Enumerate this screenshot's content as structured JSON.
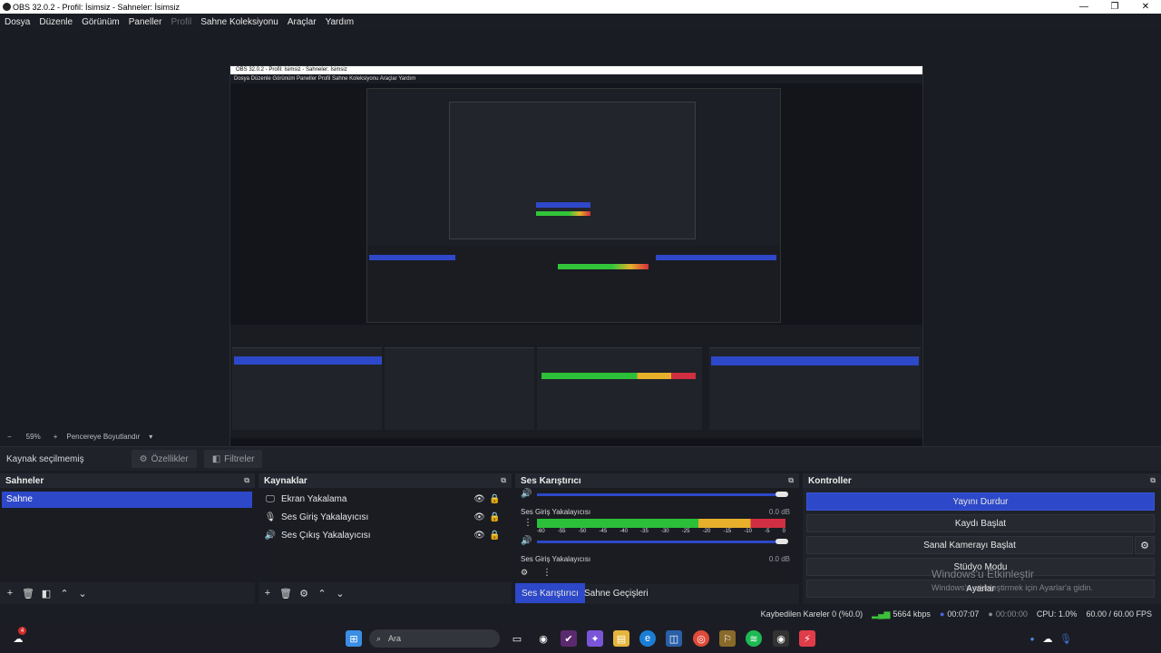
{
  "window": {
    "title": "OBS 32.0.2 - Profil: İsimsiz - Sahneler: İsimsiz",
    "controls": [
      "—",
      "❐",
      "✕"
    ]
  },
  "menu": [
    "Dosya",
    "Düzenle",
    "Görünüm",
    "Paneller",
    "Profil",
    "Sahne Koleksiyonu",
    "Araçlar",
    "Yardım"
  ],
  "preview": {
    "inner_title": "OBS 32.0.2 - Profil: İsimsiz - Sahneler: İsimsiz",
    "inner_menu": "Dosya   Düzenle   Görünüm   Paneller   Profil   Sahne Koleksiyonu   Araçlar   Yardım"
  },
  "zoom": {
    "minus": "−",
    "value": "59%",
    "plus": "+",
    "resize_label": "Pencereye Boyutlandır",
    "dropdown": "▾"
  },
  "source_bar": {
    "no_source": "Kaynak seçilmemiş",
    "properties": "Özellikler",
    "filters": "Filtreler"
  },
  "scenes": {
    "title": "Sahneler",
    "items": [
      "Sahne"
    ]
  },
  "sources": {
    "title": "Kaynaklar",
    "items": [
      {
        "label": "Ekran Yakalama",
        "icon": "monitor-icon"
      },
      {
        "label": "Ses Giriş Yakalayıcısı",
        "icon": "microphone-icon"
      },
      {
        "label": "Ses Çıkış Yakalayıcısı",
        "icon": "speaker-icon"
      }
    ]
  },
  "mixer": {
    "title": "Ses Karıştırıcı",
    "tracks": [
      {
        "label": "Ses Giriş Yakalayıcısı",
        "db": "0.0 dB"
      },
      {
        "label": "Ses Giriş Yakalayıcısı",
        "db": "0.0 dB"
      }
    ],
    "ticks": [
      "-60",
      "-55",
      "-50",
      "-45",
      "-40",
      "-35",
      "-30",
      "-25",
      "-20",
      "-15",
      "-10",
      "-5",
      "0"
    ],
    "tab_mixer": "Ses Karıştırıcı",
    "tab_transitions": "Sahne Geçişleri"
  },
  "controls": {
    "title": "Kontroller",
    "stop_stream": "Yayını Durdur",
    "start_record": "Kaydı Başlat",
    "virtual_cam": "Sanal Kamerayı Başlat",
    "studio_mode": "Stüdyo Modu",
    "settings": "Ayarlar"
  },
  "activation": {
    "line1": "Windows'u Etkinleştir",
    "line2": "Windows'u etkinleştirmek için Ayarlar'a gidin."
  },
  "status": {
    "dropped": "Kaybedilen Kareler 0 (%0.0)",
    "bitrate": "5664 kbps",
    "stream_time": "00:07:07",
    "record_time": "00:00:00",
    "cpu": "CPU: 1.0%",
    "fps": "60.00 / 60.00 FPS"
  },
  "taskbar": {
    "search": "Ara",
    "notification_count": "4"
  },
  "colors": {
    "accent": "#2d48c8",
    "meter_green": "#2cbf39",
    "meter_yellow": "#e6b02b",
    "meter_red": "#cf2f40"
  }
}
